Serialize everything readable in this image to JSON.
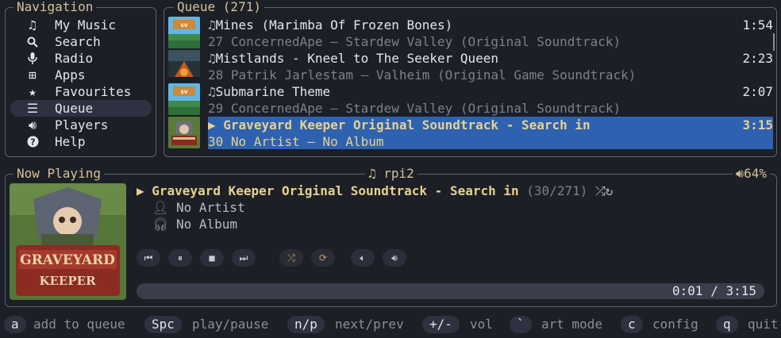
{
  "nav": {
    "title": "Navigation",
    "items": [
      {
        "label": "My Music",
        "icon": "music-note-icon"
      },
      {
        "label": "Search",
        "icon": "search-icon"
      },
      {
        "label": "Radio",
        "icon": "microphone-icon"
      },
      {
        "label": "Apps",
        "icon": "apps-grid-icon"
      },
      {
        "label": "Favourites",
        "icon": "star-icon"
      },
      {
        "label": "Queue",
        "icon": "list-icon",
        "active": true
      },
      {
        "label": "Players",
        "icon": "speaker-icon"
      },
      {
        "label": "Help",
        "icon": "help-icon"
      }
    ]
  },
  "queue": {
    "title": "Queue (271)",
    "rows": [
      {
        "title": "Mines (Marimba Of Frozen Bones)",
        "sub": "27  ConcernedApe — Stardew Valley (Original Soundtrack)",
        "duration": "1:54",
        "art": "stardew"
      },
      {
        "title": "Mistlands - Kneel to The Seeker Queen",
        "sub": "28  Patrik Jarlestam — Valheim (Original Game Soundtrack)",
        "duration": "2:23",
        "art": "valheim"
      },
      {
        "title": "Submarine Theme",
        "sub": "29  ConcernedApe — Stardew Valley (Original Soundtrack)",
        "duration": "2:07",
        "art": "stardew"
      },
      {
        "title": "Graveyard Keeper Original Soundtrack - Search in",
        "sub": "30  No Artist — No Album",
        "duration": "3:15",
        "art": "graveyard",
        "selected": true
      }
    ]
  },
  "now_playing": {
    "title": "Now Playing",
    "player": "rpi2",
    "volume": "64%",
    "track": "Graveyard Keeper Original Soundtrack - Search in",
    "position": "(30/271)",
    "artist": "No Artist",
    "album": "No Album",
    "time": "0:01 / 3:15",
    "progress_fraction": 0.005
  },
  "hints": [
    {
      "key": "a",
      "label": "add to queue"
    },
    {
      "key": "Spc",
      "label": "play/pause"
    },
    {
      "key": "n/p",
      "label": "next/prev"
    },
    {
      "key": "+/-",
      "label": "vol"
    },
    {
      "key": "`",
      "label": "art mode"
    },
    {
      "key": "c",
      "label": "config"
    },
    {
      "key": "q",
      "label": "quit"
    }
  ]
}
